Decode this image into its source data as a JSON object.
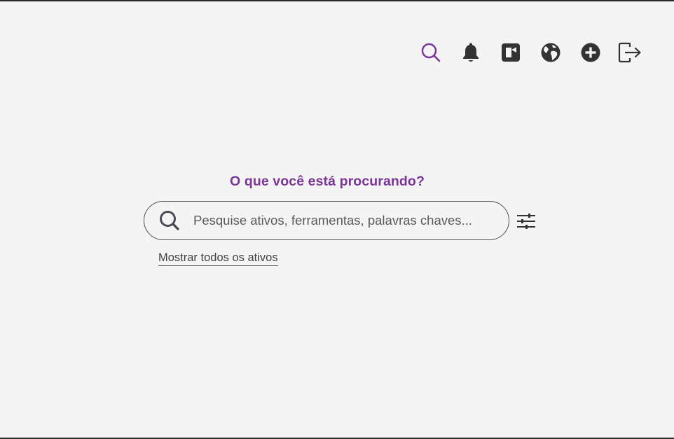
{
  "header": {
    "icons": [
      "search-icon",
      "bell-icon",
      "video-icon",
      "globe-icon",
      "add-circle-icon",
      "logout-icon"
    ]
  },
  "colors": {
    "accent": "#7b3597",
    "icon_dark": "#333333",
    "background": "#f4f4f4"
  },
  "main": {
    "heading": "O que você está procurando?",
    "search": {
      "placeholder": "Pesquise ativos, ferramentas, palavras chaves...",
      "value": ""
    },
    "show_all_link": "Mostrar todos os ativos"
  }
}
